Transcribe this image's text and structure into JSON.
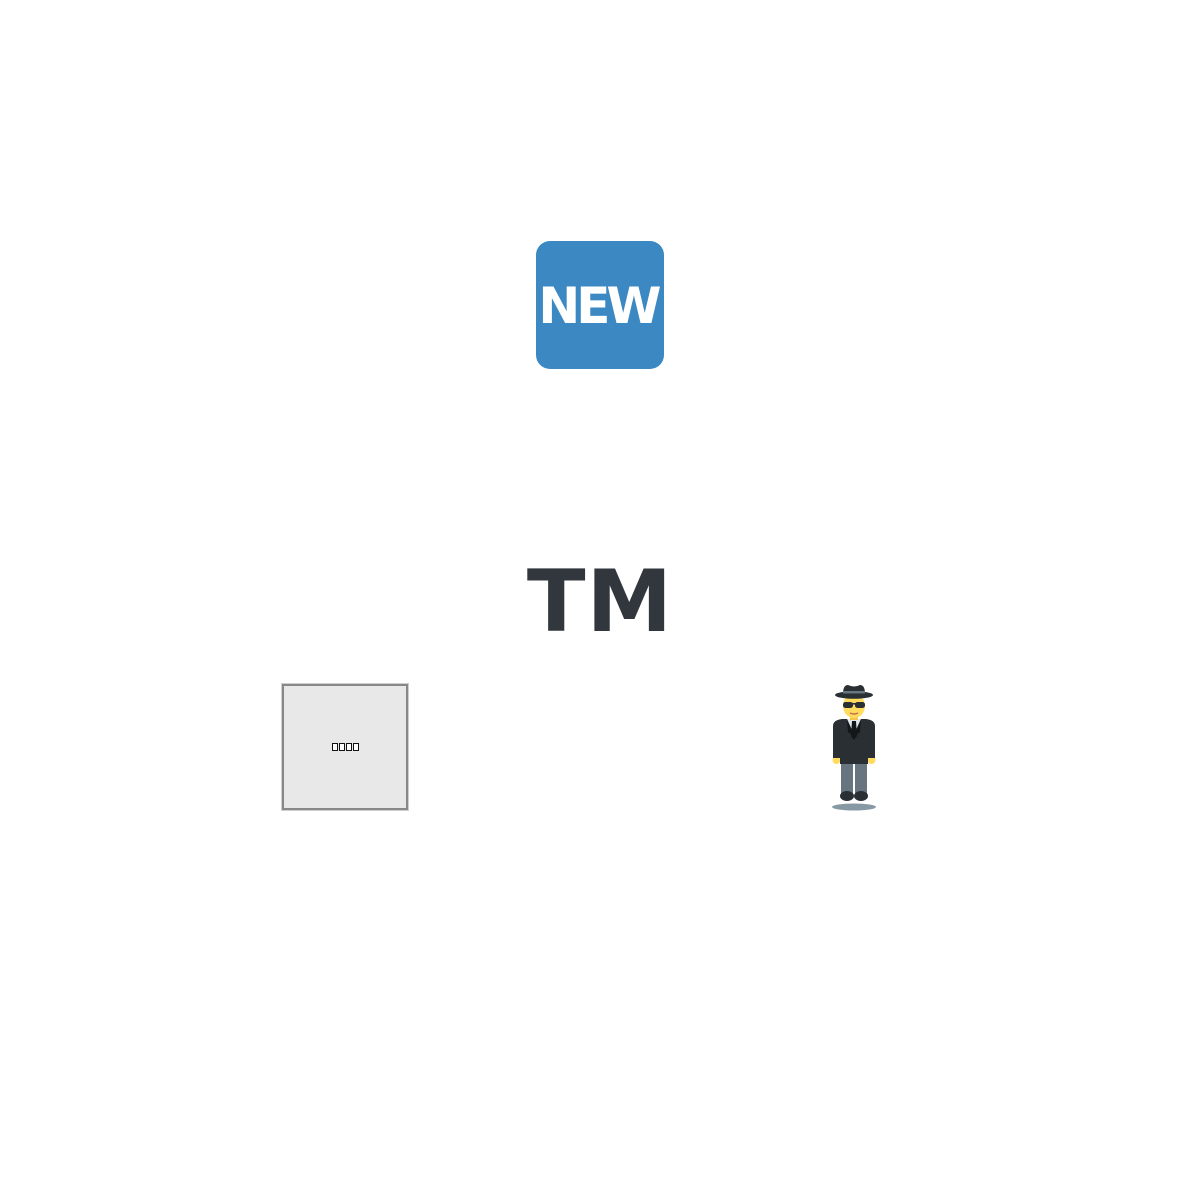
{
  "badges": {
    "new_label": "NEW",
    "new_color": "#3b88c3",
    "tm_label": "TM",
    "tm_color": "#31373d"
  },
  "icons": [
    {
      "name": "new-button-icon",
      "glyph": "🆕"
    },
    {
      "name": "trade-mark-icon",
      "glyph": "™"
    },
    {
      "name": "missing-glyph-icon",
      "glyph": "unrendered"
    },
    {
      "name": "man-in-business-suit-levitating-icon",
      "glyph": "🕴"
    }
  ]
}
